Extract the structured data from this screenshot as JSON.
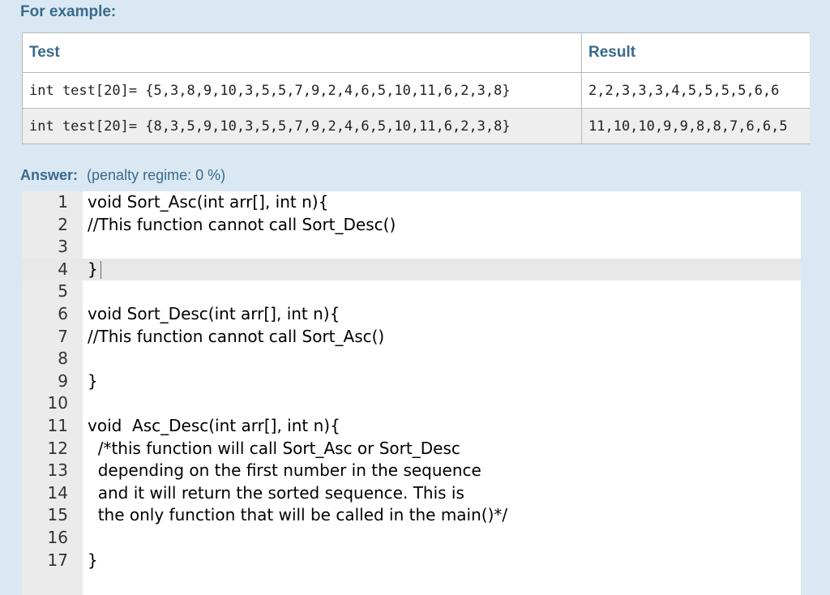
{
  "examples": {
    "heading": "For example:",
    "headers": {
      "test": "Test",
      "result": "Result"
    },
    "rows": [
      {
        "test": "int test[20]= {5,3,8,9,10,3,5,5,7,9,2,4,6,5,10,11,6,2,3,8}",
        "result": "2,2,3,3,3,4,5,5,5,5,6,6"
      },
      {
        "test": "int test[20]= {8,3,5,9,10,3,5,5,7,9,2,4,6,5,10,11,6,2,3,8}",
        "result": "11,10,10,9,9,8,8,7,6,6,5"
      }
    ]
  },
  "answer": {
    "label": "Answer:",
    "penalty": "(penalty regime: 0 %)"
  },
  "editor": {
    "active_line": 4,
    "lines": [
      {
        "num": "1",
        "text": "void Sort_Asc(int arr[], int n){"
      },
      {
        "num": "2",
        "text": "//This function cannot call Sort_Desc()"
      },
      {
        "num": "3",
        "text": ""
      },
      {
        "num": "4",
        "text": "}"
      },
      {
        "num": "5",
        "text": ""
      },
      {
        "num": "6",
        "text": "void Sort_Desc(int arr[], int n){"
      },
      {
        "num": "7",
        "text": "//This function cannot call Sort_Asc()"
      },
      {
        "num": "8",
        "text": ""
      },
      {
        "num": "9",
        "text": "}"
      },
      {
        "num": "10",
        "text": ""
      },
      {
        "num": "11",
        "text": "void  Asc_Desc(int arr[], int n){"
      },
      {
        "num": "12",
        "text": "  /*this function will call Sort_Asc or Sort_Desc"
      },
      {
        "num": "13",
        "text": "  depending on the first number in the sequence"
      },
      {
        "num": "14",
        "text": "  and it will return the sorted sequence. This is"
      },
      {
        "num": "15",
        "text": "  the only function that will be called in the main()*/"
      },
      {
        "num": "16",
        "text": ""
      },
      {
        "num": "17",
        "text": "}"
      }
    ]
  }
}
